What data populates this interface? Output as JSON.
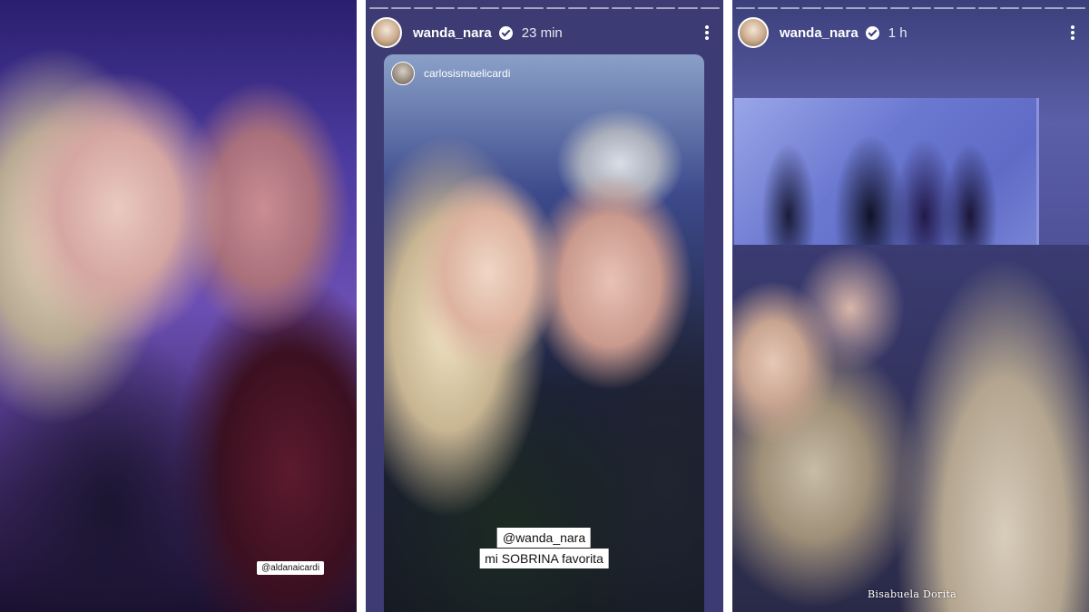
{
  "panels": [
    {
      "tag": "@aldanaicardi"
    },
    {
      "header": {
        "username": "wanda_nara",
        "time": "23 min",
        "avatar_icon": "profile-avatar",
        "verified_icon": "verified-badge-icon",
        "menu_icon": "more-vertical-icon"
      },
      "shared_post": {
        "username": "carlosismaelicardi",
        "mention": "@wanda_nara",
        "caption": "mi SOBRINA favorita"
      }
    },
    {
      "header": {
        "username": "wanda_nara",
        "time": "1 h",
        "avatar_icon": "profile-avatar",
        "verified_icon": "verified-badge-icon",
        "menu_icon": "more-vertical-icon"
      },
      "caption": "Bisabuela  Dorita"
    }
  ],
  "colors": {
    "story_background": "#3d3b73",
    "text": "#ffffff",
    "label_background": "#ffffff"
  }
}
